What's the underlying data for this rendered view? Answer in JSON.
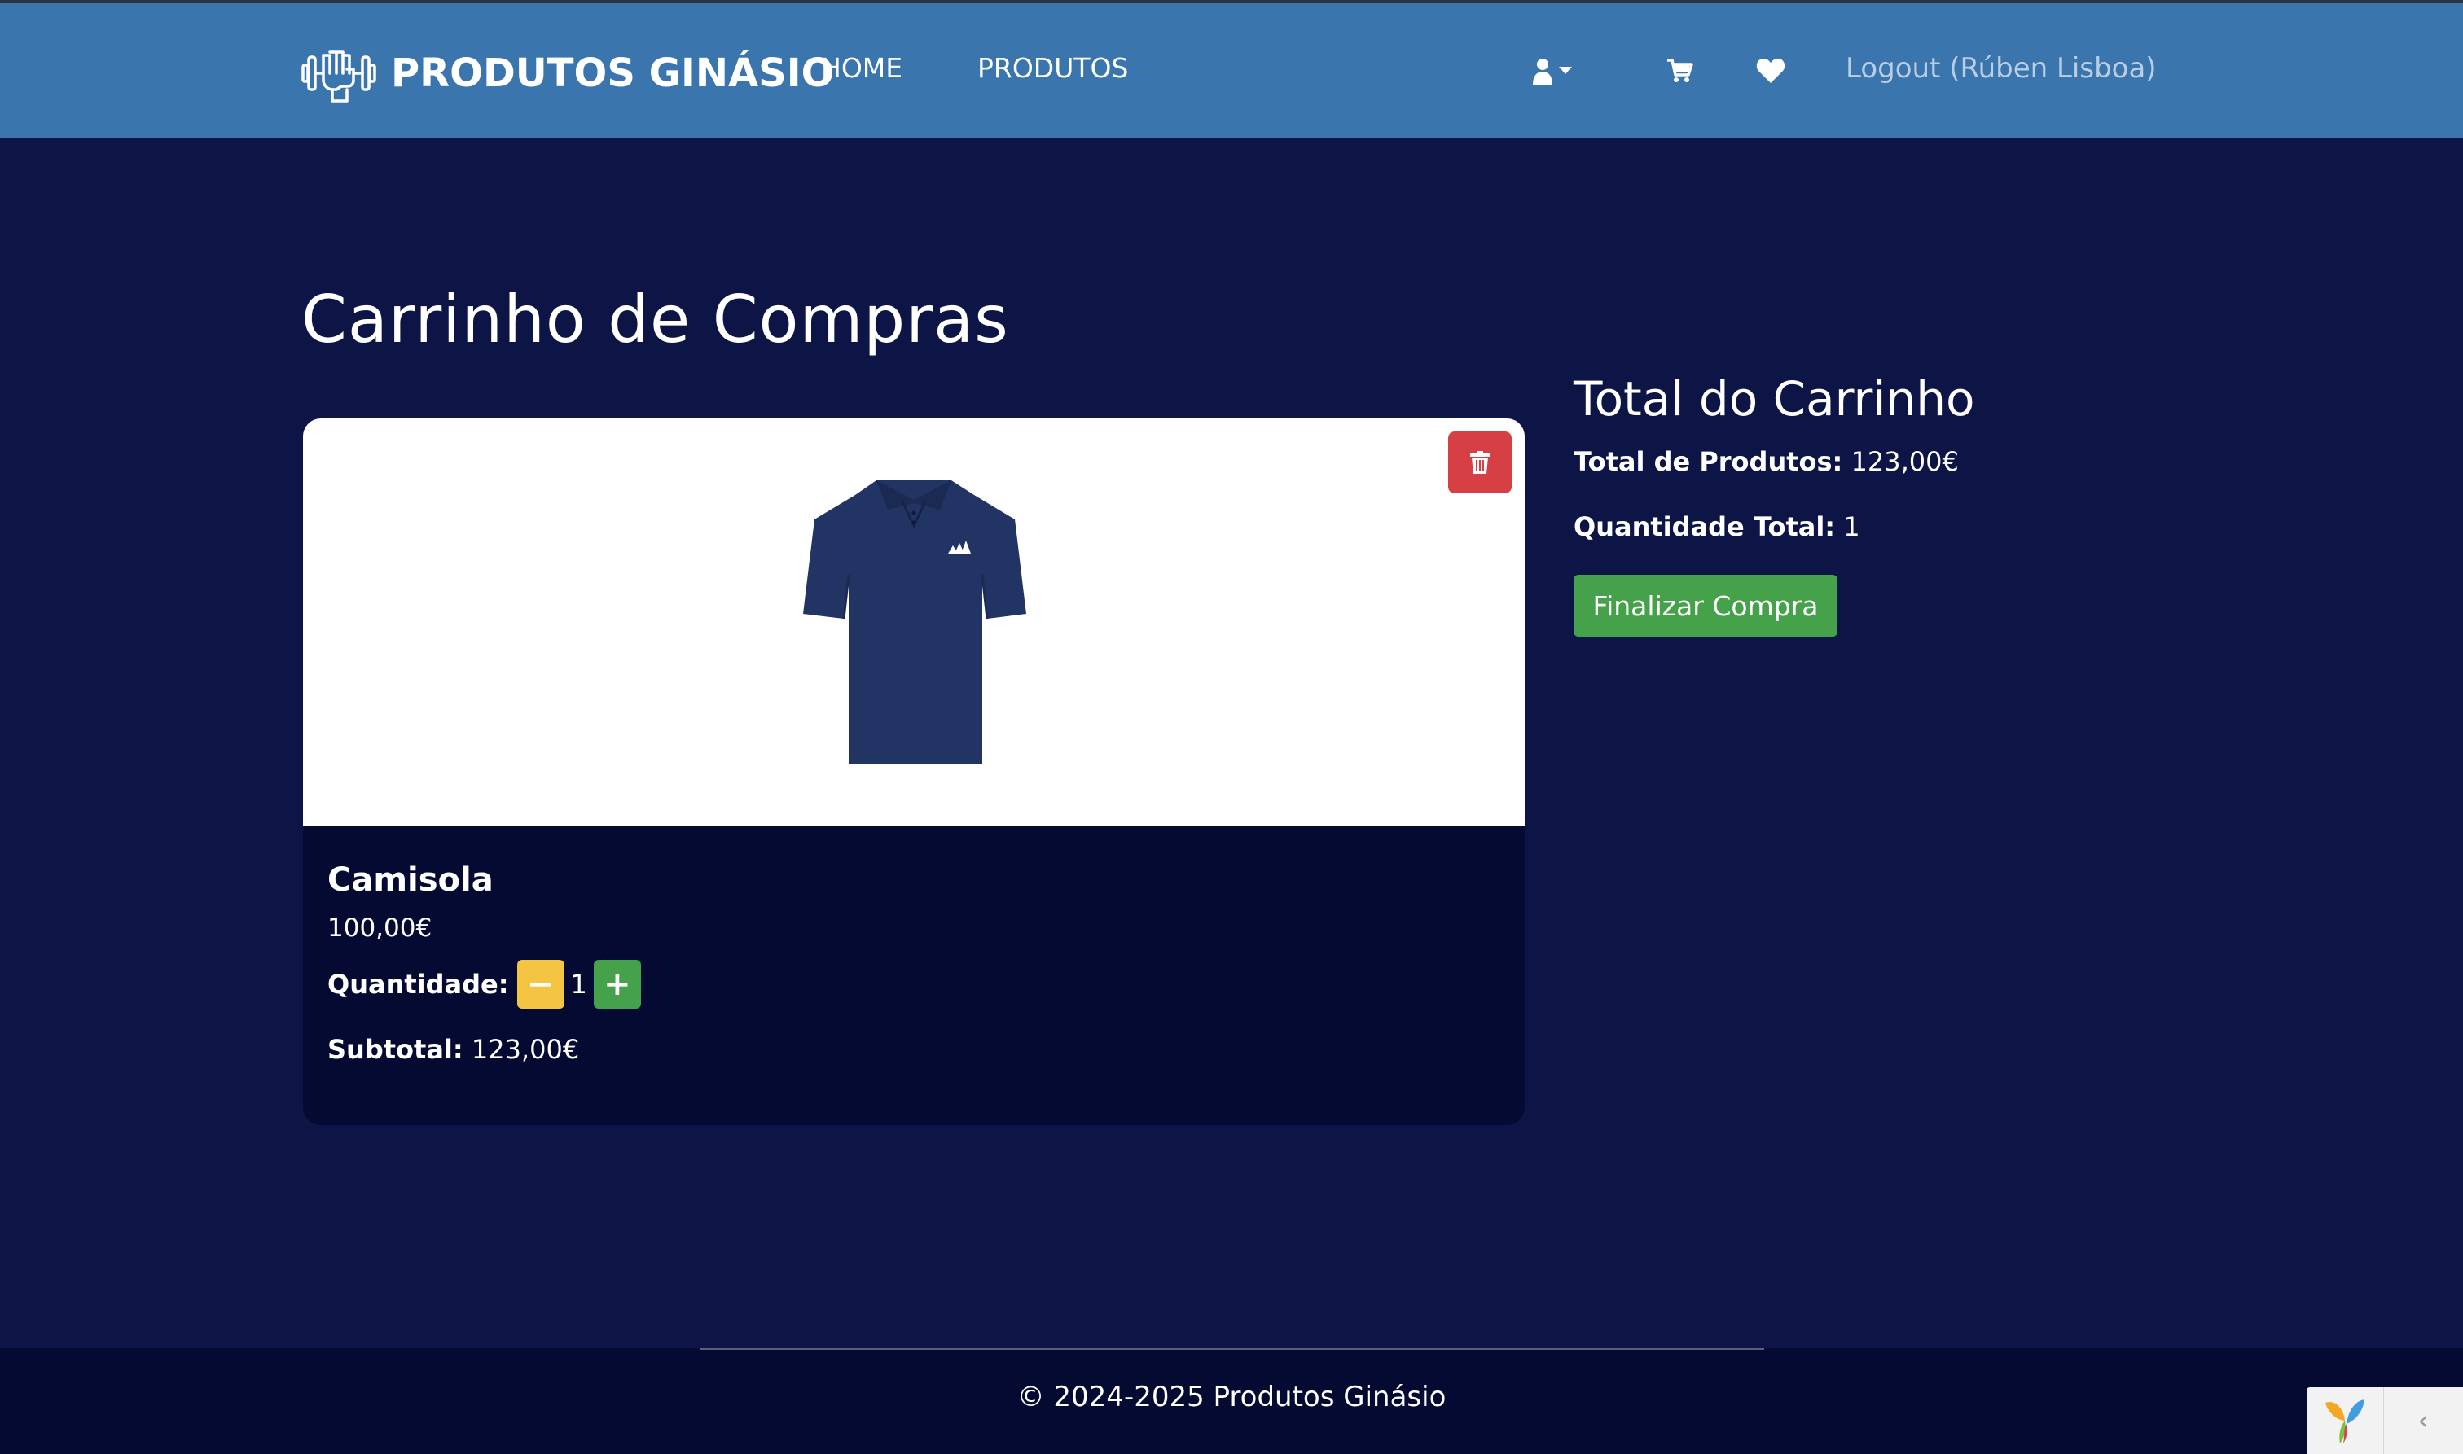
{
  "navbar": {
    "brand": "PRODUTOS GINÁSIO",
    "links": [
      {
        "label": "HOME"
      },
      {
        "label": "PRODUTOS"
      }
    ],
    "icons": [
      "user-icon",
      "cart-icon",
      "heart-icon"
    ],
    "logout_label": "Logout (Rúben Lisboa)"
  },
  "page": {
    "title": "Carrinho de Compras"
  },
  "cart_item": {
    "name": "Camisola",
    "price": "100,00€",
    "quantity_label": "Quantidade:",
    "quantity": "1",
    "minus_label": "−",
    "plus_label": "+",
    "subtotal_label": "Subtotal:",
    "subtotal": "123,00€"
  },
  "summary": {
    "title": "Total do Carrinho",
    "total_label": "Total de Produtos:",
    "total_value": "123,00€",
    "qty_label": "Quantidade Total:",
    "qty_value": "1",
    "checkout_label": "Finalizar Compra"
  },
  "footer": {
    "text": "© 2024-2025 Produtos Ginásio"
  },
  "colors": {
    "navbar": "#3a75ad",
    "background": "#0c1545",
    "card": "#050a33",
    "danger": "#d64045",
    "warning": "#f3c542",
    "success": "#46a24a"
  }
}
